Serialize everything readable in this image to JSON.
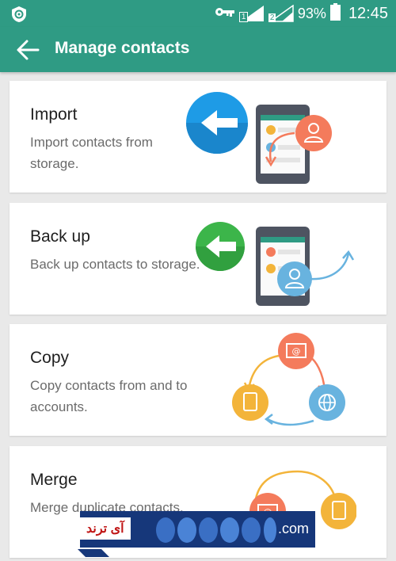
{
  "status_bar": {
    "battery_percent": "93%",
    "time": "12:45",
    "sim1_label": "1",
    "sim2_label": "2",
    "icons": [
      "app-shield-icon",
      "key-icon",
      "signal-sim1-icon",
      "signal-sim2-icon",
      "battery-icon"
    ]
  },
  "app_bar": {
    "title": "Manage contacts",
    "back_icon": "arrow-left-icon"
  },
  "cards": [
    {
      "title": "Import",
      "description": "Import contacts from storage.",
      "icon": "import-illustration"
    },
    {
      "title": "Back up",
      "description": "Back up contacts to storage.",
      "icon": "backup-illustration"
    },
    {
      "title": "Copy",
      "description": "Copy contacts from and to accounts.",
      "icon": "copy-illustration"
    },
    {
      "title": "Merge",
      "description": "Merge duplicate contacts.",
      "icon": "merge-illustration"
    }
  ],
  "colors": {
    "accent": "#2f9b84",
    "blue_arrow": "#1e9be6",
    "green_arrow": "#3cb54a",
    "orange": "#f47b5c",
    "yellow": "#f3b43a",
    "light_blue": "#68b3df",
    "phone_dark": "#4e5461"
  },
  "watermark": {
    "text": ".com",
    "fa_text": "آی ترند"
  }
}
